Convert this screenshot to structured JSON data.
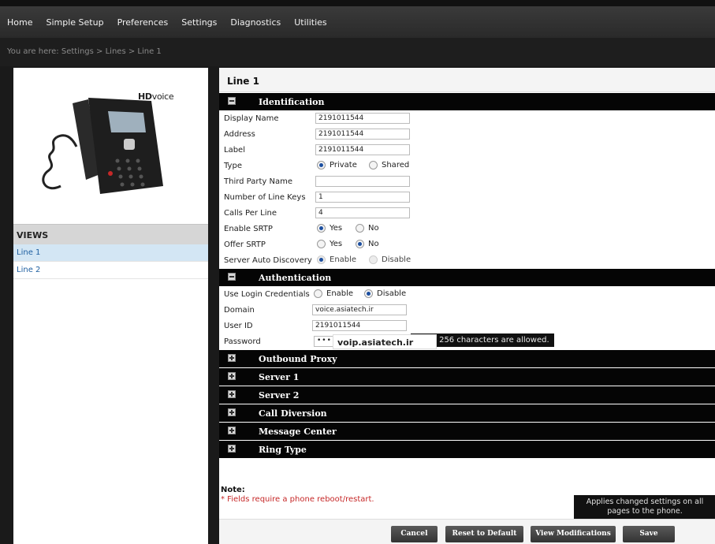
{
  "nav": {
    "items": [
      "Home",
      "Simple Setup",
      "Preferences",
      "Settings",
      "Diagnostics",
      "Utilities"
    ]
  },
  "breadcrumb": "You are here: Settings > Lines > Line 1",
  "phone": {
    "hd_prefix": "HD",
    "hd_suffix": "voice"
  },
  "views": {
    "heading": "VIEWS",
    "items": [
      "Line 1",
      "Line 2"
    ]
  },
  "page_title": "Line 1",
  "identification": {
    "title": "Identification",
    "display_name_label": "Display Name",
    "display_name": "2191011544",
    "address_label": "Address",
    "address": "2191011544",
    "label_label": "Label",
    "label": "2191011544",
    "type_label": "Type",
    "type_private": "Private",
    "type_shared": "Shared",
    "third_party_label": "Third Party Name",
    "third_party": "",
    "line_keys_label": "Number of Line Keys",
    "line_keys": "1",
    "calls_label": "Calls Per Line",
    "calls": "4",
    "srtp_label": "Enable SRTP",
    "srtp_yes": "Yes",
    "srtp_no": "No",
    "offer_label": "Offer SRTP",
    "offer_yes": "Yes",
    "offer_no": "No",
    "discovery_label": "Server Auto Discovery",
    "discovery_enable": "Enable",
    "discovery_disable": "Disable"
  },
  "authentication": {
    "title": "Authentication",
    "creds_label": "Use Login Credentials",
    "creds_enable": "Enable",
    "creds_disable": "Disable",
    "domain_label": "Domain",
    "domain": "voice.asiatech.ir",
    "userid_label": "User ID",
    "userid": "2191011544",
    "password_label": "Password",
    "password_dots": "••••",
    "password_tooltip": "um of 256 characters are allowed.",
    "overlay_text": "voip.asiatech.ir"
  },
  "collapsed_sections": [
    "Outbound Proxy",
    "Server 1",
    "Server 2",
    "Call Diversion",
    "Message Center",
    "Ring Type"
  ],
  "note": {
    "heading": "Note:",
    "text": "* Fields require a phone reboot/restart."
  },
  "hint": {
    "line1": "Applies changed settings on all",
    "line2": "pages to the phone."
  },
  "buttons": {
    "cancel": "Cancel",
    "reset": "Reset to Default",
    "view": "View Modifications",
    "save": "Save"
  }
}
